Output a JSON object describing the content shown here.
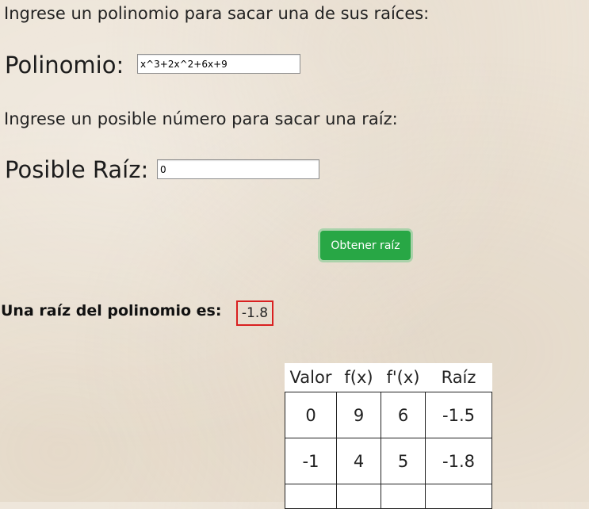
{
  "form": {
    "instruction_polynomial": "Ingrese un polinomio para sacar una de sus raíces:",
    "polynomial_label": "Polinomio:",
    "polynomial_value": "x^3+2x^2+6x+9",
    "instruction_root": "Ingrese un posible número para sacar una raíz:",
    "root_label": "Posible Raíz:",
    "root_value": "0",
    "submit_label": "Obtener raíz"
  },
  "result": {
    "label": "Una raíz del polinomio es:",
    "value": "-1.8"
  },
  "table": {
    "headers": [
      "Valor",
      "f(x)",
      "f'(x)",
      "Raíz"
    ],
    "rows": [
      [
        "0",
        "9",
        "6",
        "-1.5"
      ],
      [
        "-1",
        "4",
        "5",
        "-1.8"
      ],
      [
        "",
        "",
        "",
        ""
      ]
    ]
  },
  "colors": {
    "button_bg": "#28a745",
    "result_border": "#d92020",
    "background": "#ece3d6"
  }
}
